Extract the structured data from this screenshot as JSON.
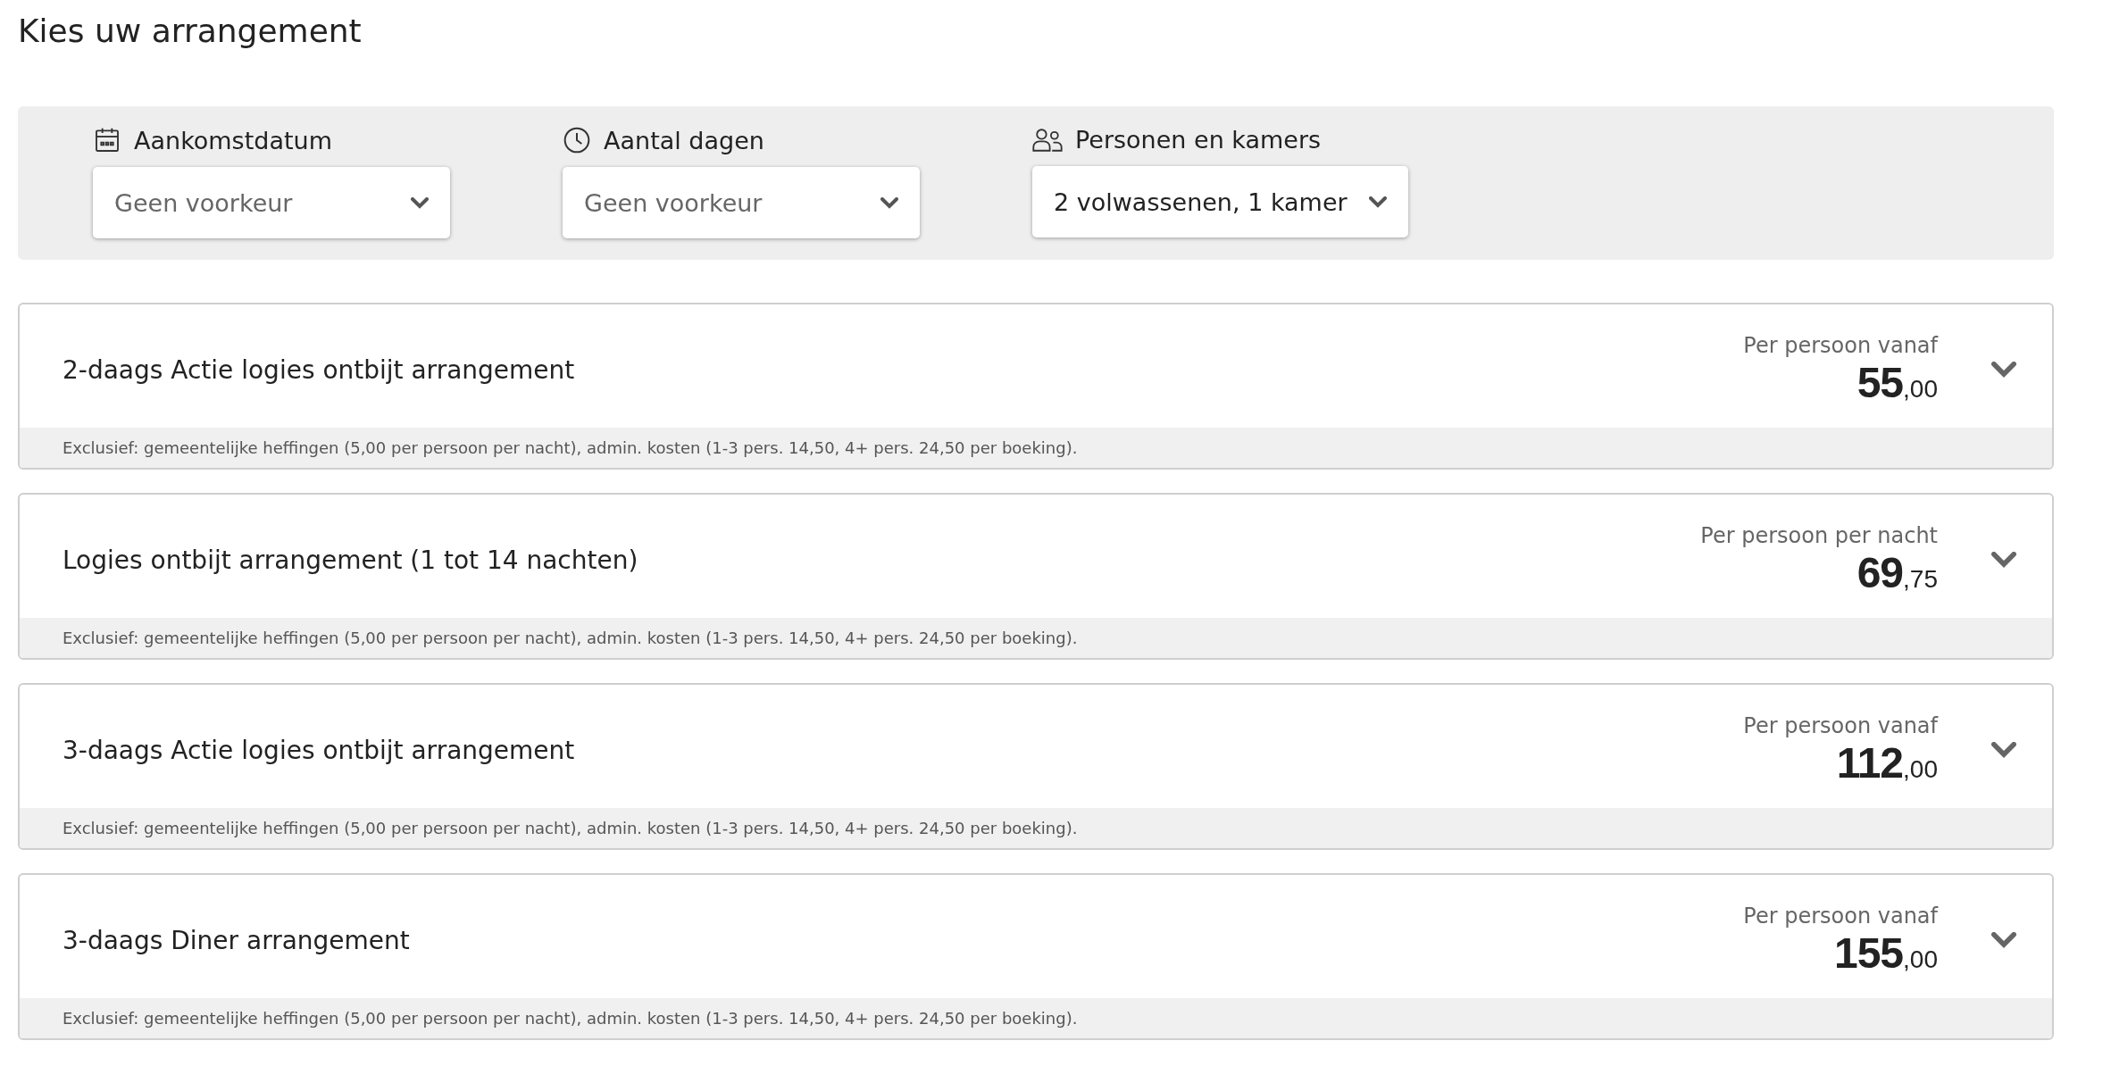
{
  "title": "Kies uw arrangement",
  "filters": [
    {
      "label": "Aankomstdatum",
      "value": "Geen voorkeur",
      "placeholder_style": true
    },
    {
      "label": "Aantal dagen",
      "value": "Geen voorkeur",
      "placeholder_style": true
    },
    {
      "label": "Personen en kamers",
      "value": "2 volwassenen, 1 kamer",
      "placeholder_style": false
    }
  ],
  "packages": [
    {
      "name": "2-daags Actie logies ontbijt arrangement",
      "price_label": "Per persoon vanaf",
      "price": {
        "whole": "55",
        "cents": ",00"
      },
      "note": "Exclusief: gemeentelijke heffingen (5,00 per persoon per nacht), admin. kosten (1-3 pers. 14,50, 4+ pers. 24,50 per boeking).",
      "expanded": false
    },
    {
      "name": "Logies ontbijt arrangement (1 tot 14 nachten)",
      "price_label": "Per persoon per nacht",
      "price": {
        "whole": "69",
        "cents": ",75"
      },
      "note": "Exclusief: gemeentelijke heffingen (5,00 per persoon per nacht), admin. kosten (1-3 pers. 14,50, 4+ pers. 24,50 per boeking).",
      "expanded": false
    },
    {
      "name": "3-daags Actie logies ontbijt arrangement",
      "price_label": "Per persoon vanaf",
      "price": {
        "whole": "112",
        "cents": ",00"
      },
      "note": "Exclusief: gemeentelijke heffingen (5,00 per persoon per nacht), admin. kosten (1-3 pers. 14,50, 4+ pers. 24,50 per boeking).",
      "expanded": false
    },
    {
      "name": "3-daags Diner arrangement",
      "price_label": "Per persoon vanaf",
      "price": {
        "whole": "155",
        "cents": ",00"
      },
      "note": "Exclusief: gemeentelijke heffingen (5,00 per persoon per nacht), admin. kosten (1-3 pers. 14,50, 4+ pers. 24,50 per boeking).",
      "expanded": false
    }
  ]
}
